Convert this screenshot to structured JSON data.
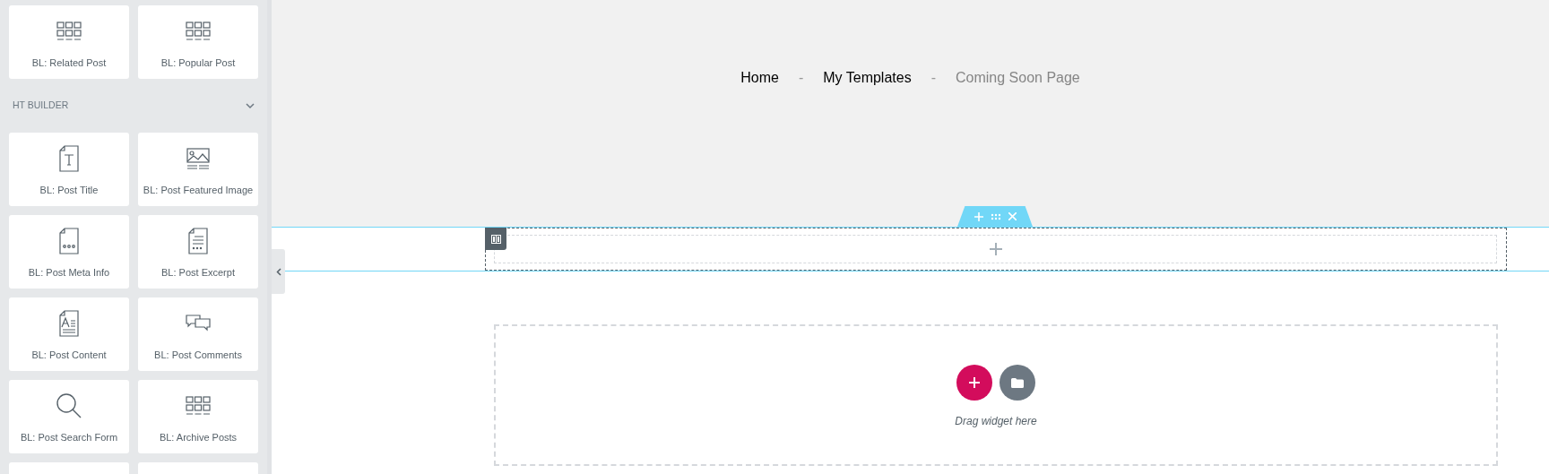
{
  "panel": {
    "widgets_before": [
      {
        "label": "BL: Related Post",
        "kind": "grid"
      },
      {
        "label": "BL: Popular Post",
        "kind": "grid"
      }
    ],
    "category": {
      "title": "HT BUILDER",
      "expanded": true
    },
    "widgets": [
      {
        "label": "BL: Post Title",
        "kind": "title"
      },
      {
        "label": "BL: Post Featured Image",
        "kind": "image"
      },
      {
        "label": "BL: Post Meta Info",
        "kind": "meta"
      },
      {
        "label": "BL: Post Excerpt",
        "kind": "excerpt"
      },
      {
        "label": "BL: Post Content",
        "kind": "content"
      },
      {
        "label": "BL: Post Comments",
        "kind": "comments"
      },
      {
        "label": "BL: Post Search Form",
        "kind": "search"
      },
      {
        "label": "BL: Archive Posts",
        "kind": "grid"
      }
    ]
  },
  "breadcrumbs": [
    {
      "kind": "link",
      "label": "Home",
      "current": false
    },
    {
      "kind": "separator",
      "label": "-"
    },
    {
      "kind": "link",
      "label": "My Templates",
      "current": false
    },
    {
      "kind": "separator",
      "label": "-"
    },
    {
      "kind": "link",
      "label": "Coming Soon Page",
      "current": true
    }
  ],
  "drop_area": {
    "hint": "Drag widget here"
  }
}
